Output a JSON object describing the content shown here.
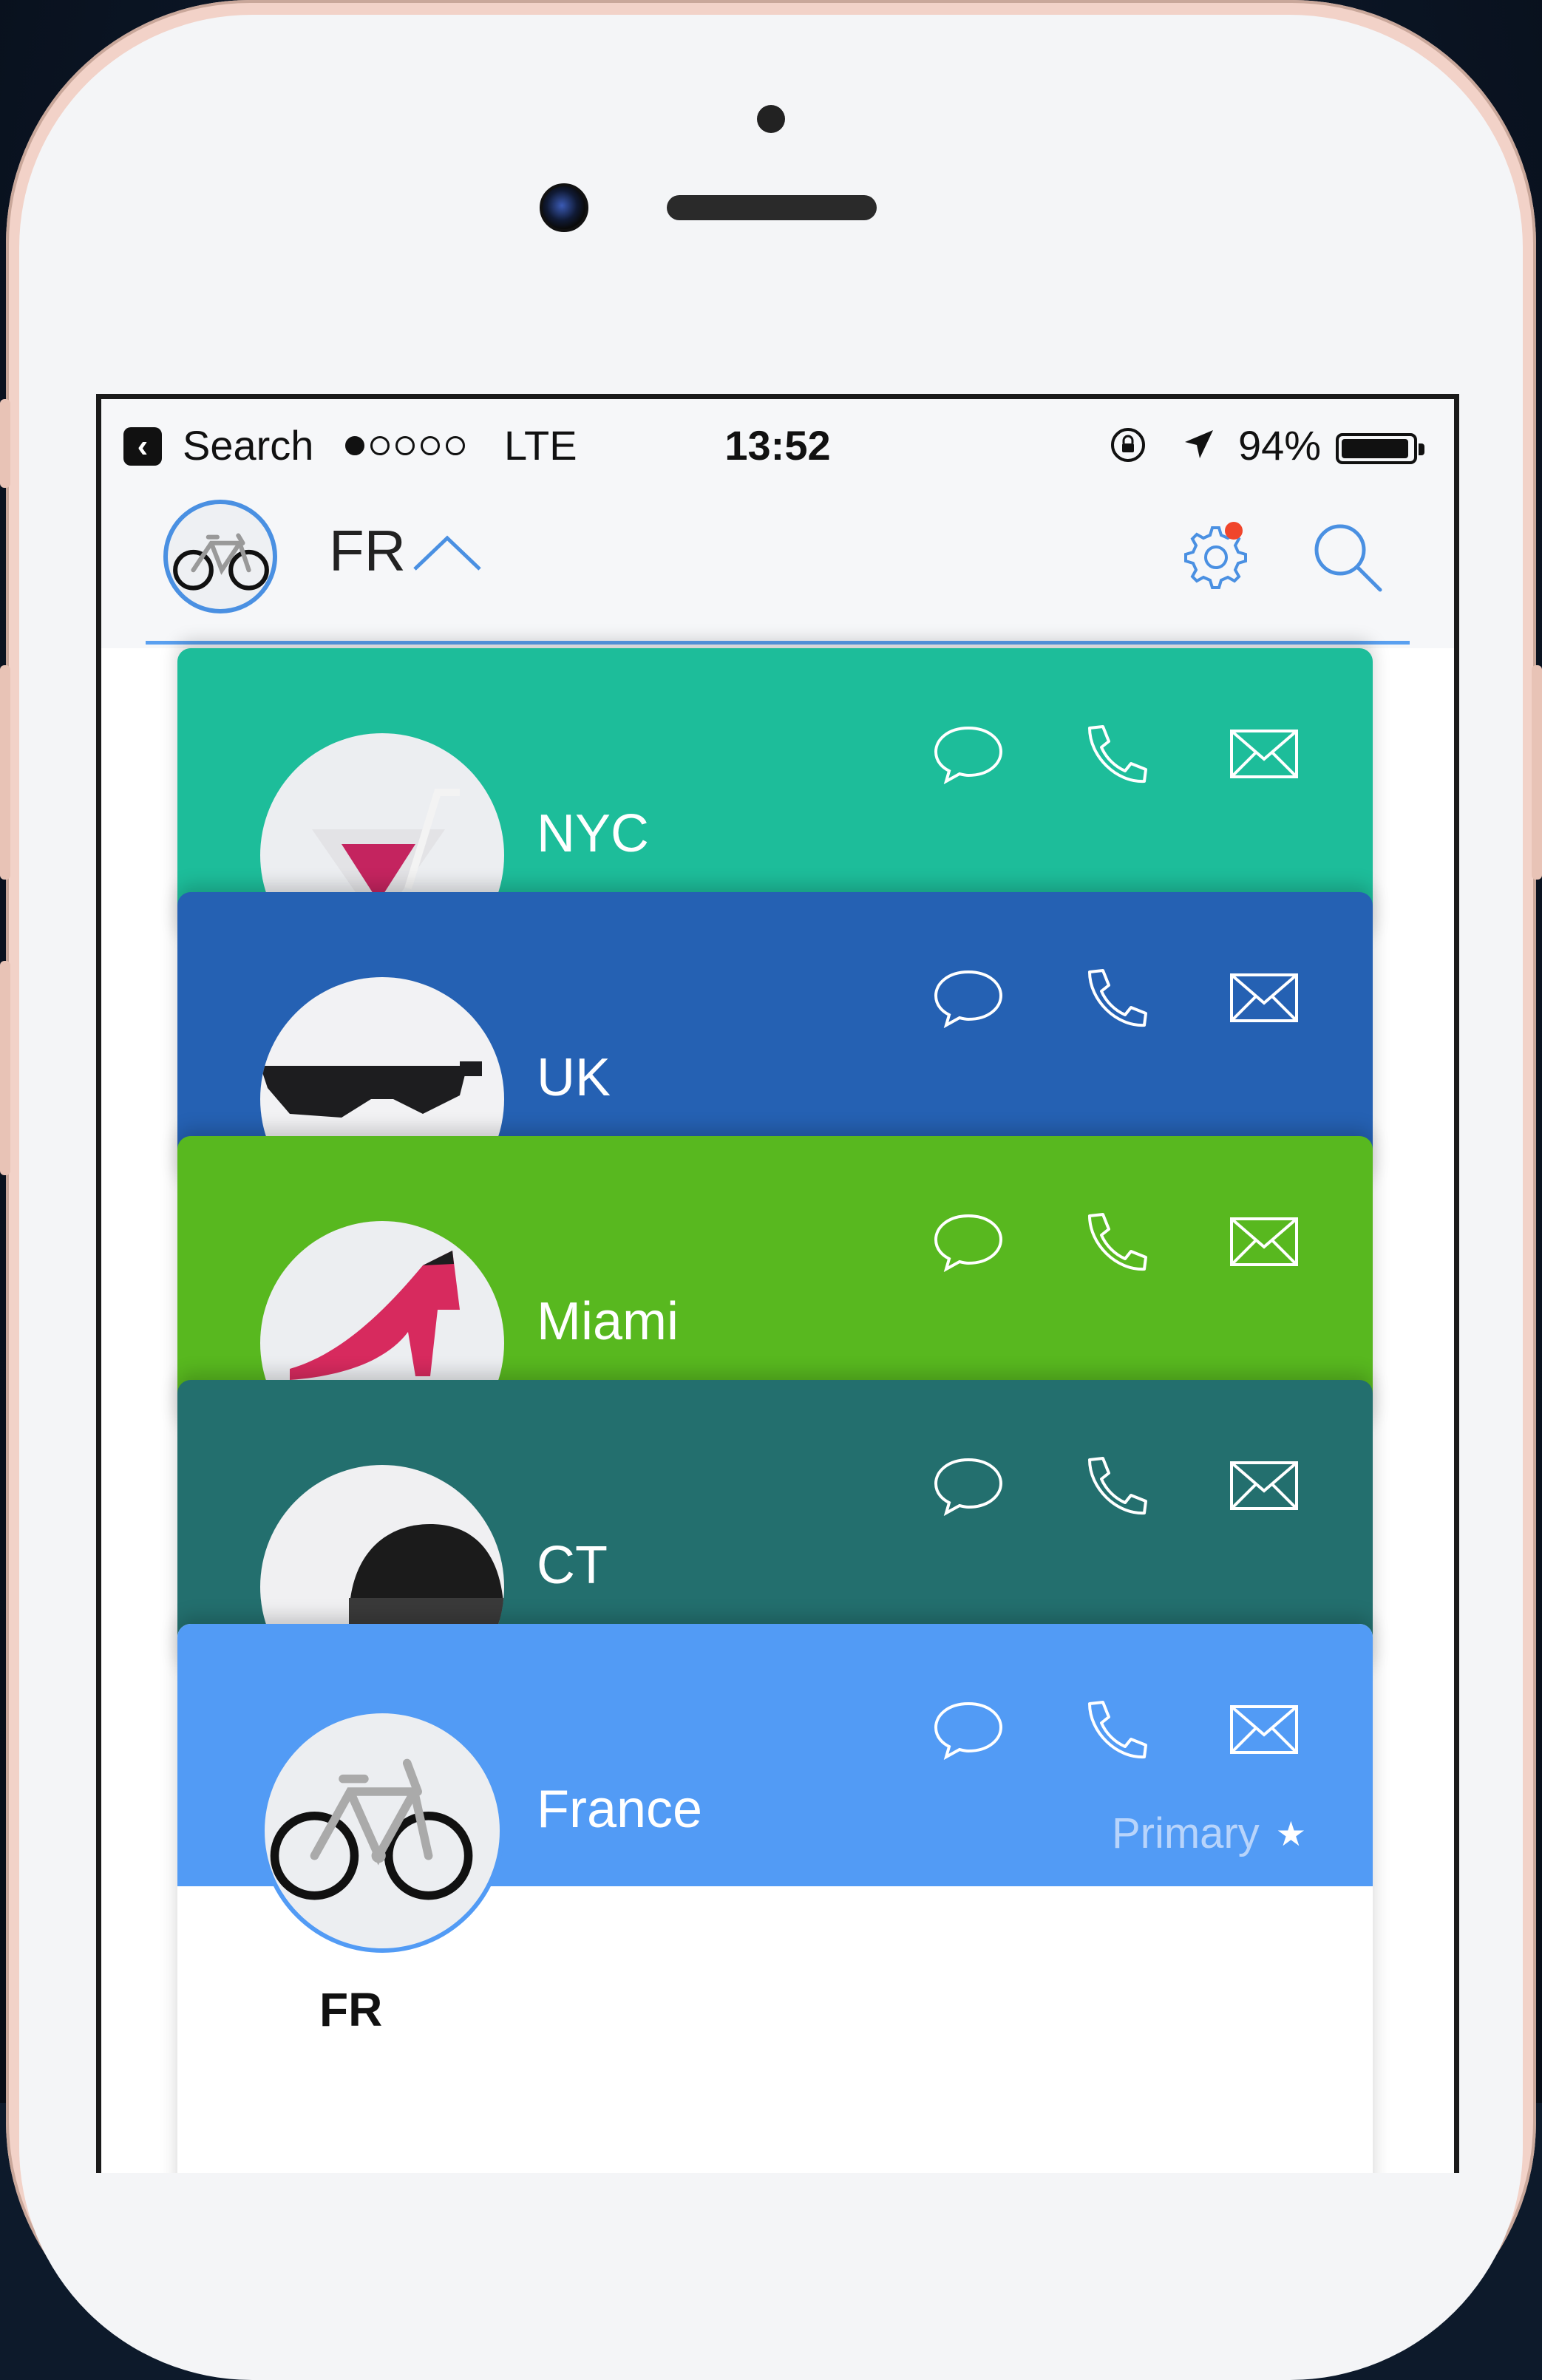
{
  "status_bar": {
    "back_app": "Search",
    "carrier": "LTE",
    "time": "13:52",
    "battery": "94%",
    "signal_bars_filled": 1,
    "signal_bars_total": 5
  },
  "nav": {
    "title": "FR",
    "avatar_icon": "bicycle-icon",
    "settings_icon": "gear-icon",
    "settings_badge_color": "#f0452b",
    "search_icon": "search-icon",
    "accent": "#4a90e2"
  },
  "cards": [
    {
      "label": "NYC",
      "color": "#1dbd9a",
      "avatar_icon": "cocktail-icon"
    },
    {
      "label": "UK",
      "color": "#2561b3",
      "avatar_icon": "sunglasses-icon"
    },
    {
      "label": "Miami",
      "color": "#58b81f",
      "avatar_icon": "high-heel-icon"
    },
    {
      "label": "CT",
      "color": "#236f6e",
      "avatar_icon": "helmet-icon"
    },
    {
      "label": "France",
      "color": "#529bf5",
      "avatar_icon": "bicycle-icon",
      "badge": "Primary",
      "badge_icon": "star-icon"
    }
  ],
  "card_actions": [
    "message-icon",
    "phone-icon",
    "mail-icon"
  ],
  "profile": {
    "name": "FR"
  }
}
